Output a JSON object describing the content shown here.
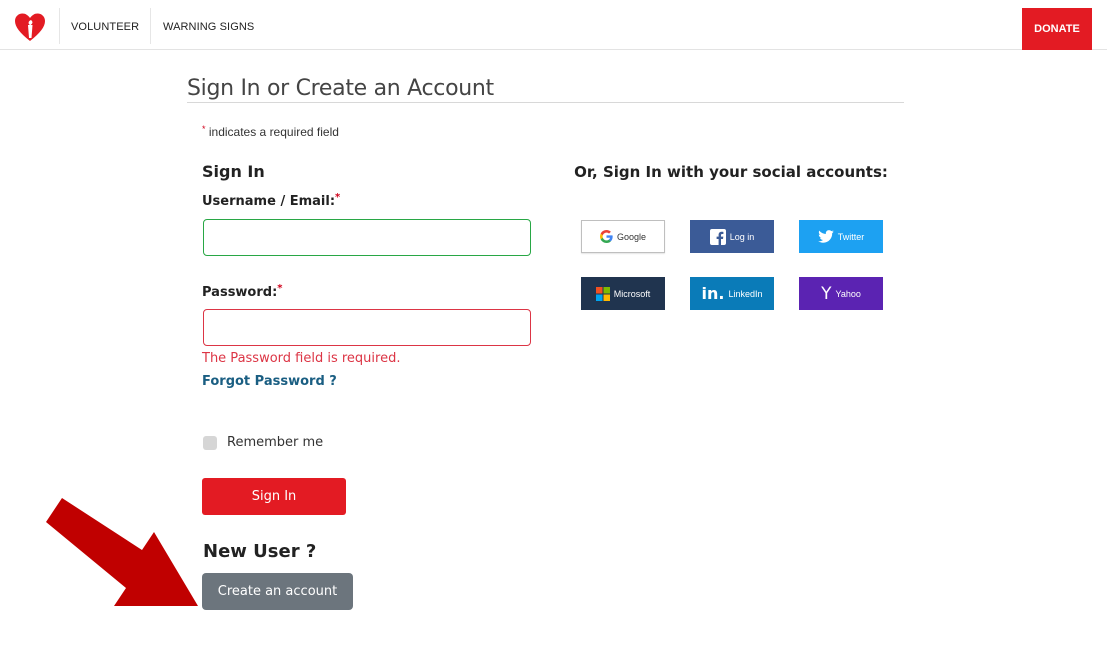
{
  "header": {
    "nav": [
      {
        "label": "VOLUNTEER"
      },
      {
        "label": "WARNING SIGNS"
      }
    ],
    "donate_label": "DONATE"
  },
  "page": {
    "title": "Sign In or Create an Account",
    "required_note": "indicates a required field",
    "required_marker": "*"
  },
  "signin": {
    "heading": "Sign In",
    "username_label": "Username / Email:",
    "username_value": "",
    "password_label": "Password:",
    "password_value": "",
    "password_error": "The Password field is required.",
    "forgot_label": "Forgot Password ?",
    "remember_label": "Remember me",
    "remember_checked": false,
    "submit_label": "Sign In"
  },
  "newuser": {
    "heading": "New User ?",
    "create_label": "Create an account"
  },
  "social": {
    "heading": "Or, Sign In with your social accounts:",
    "buttons": [
      {
        "label": "Google",
        "icon": "google-g-icon",
        "color": "#ffffff"
      },
      {
        "label": "Log in",
        "icon": "facebook-f-icon",
        "color": "#3b5b97"
      },
      {
        "label": "Twitter",
        "icon": "twitter-bird-icon",
        "color": "#1da1f2"
      },
      {
        "label": "Microsoft",
        "icon": "microsoft-logo-icon",
        "color": "#20344f"
      },
      {
        "label": "LinkedIn",
        "icon": "linkedin-in-icon",
        "color": "#0a7bb8"
      },
      {
        "label": "Yahoo",
        "icon": "yahoo-y-icon",
        "color": "#5b23b2"
      }
    ]
  },
  "colors": {
    "brand_red": "#e31b23",
    "error_red": "#dc3545",
    "valid_green": "#28a745",
    "link_blue": "#1a5e82",
    "secondary_gray": "#6c757d",
    "annotation_arrow": "#c00000"
  }
}
